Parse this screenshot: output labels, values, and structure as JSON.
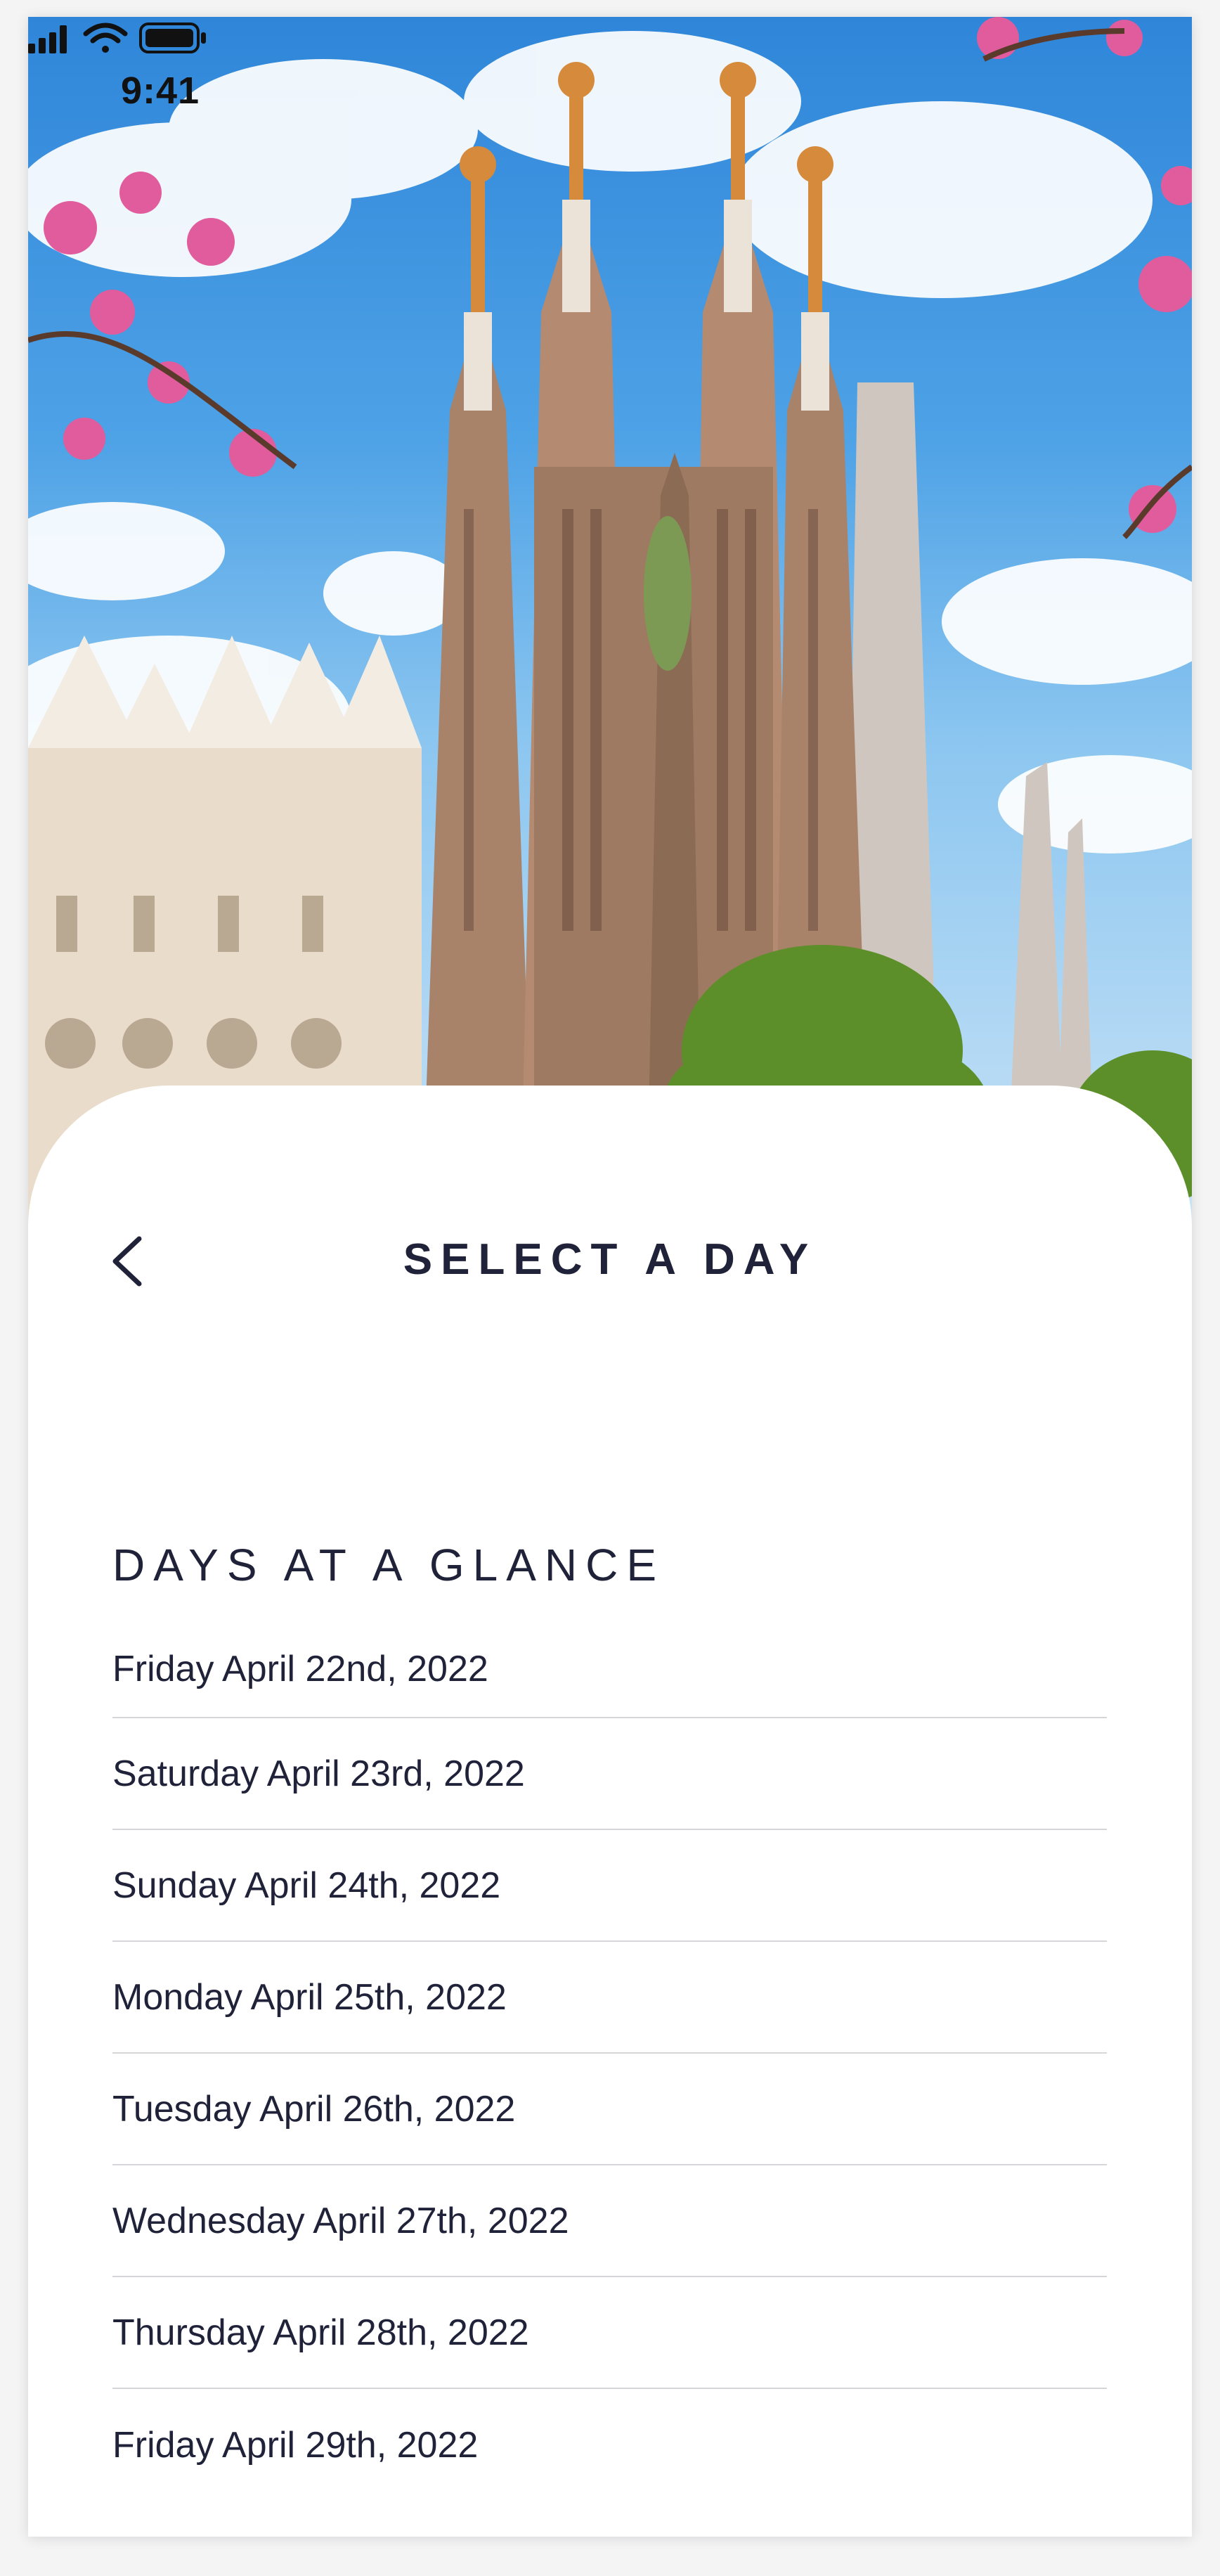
{
  "status_bar": {
    "time": "9:41",
    "icons": [
      "signal-icon",
      "wifi-icon",
      "battery-icon"
    ]
  },
  "hero": {
    "image": "sagrada-familia-photo"
  },
  "header": {
    "back_icon": "chevron-left-icon",
    "title": "SELECT A DAY"
  },
  "section": {
    "title": "DAYS AT A GLANCE"
  },
  "days": [
    "Friday April 22nd, 2022",
    "Saturday April 23rd, 2022",
    "Sunday April 24th, 2022",
    "Monday April 25th, 2022",
    "Tuesday April 26th, 2022",
    "Wednesday April 27th, 2022",
    "Thursday April 28th, 2022",
    "Friday April 29th, 2022"
  ],
  "colors": {
    "text": "#1f2238",
    "divider": "#d6d6da",
    "sky": "#4ea2e6"
  }
}
